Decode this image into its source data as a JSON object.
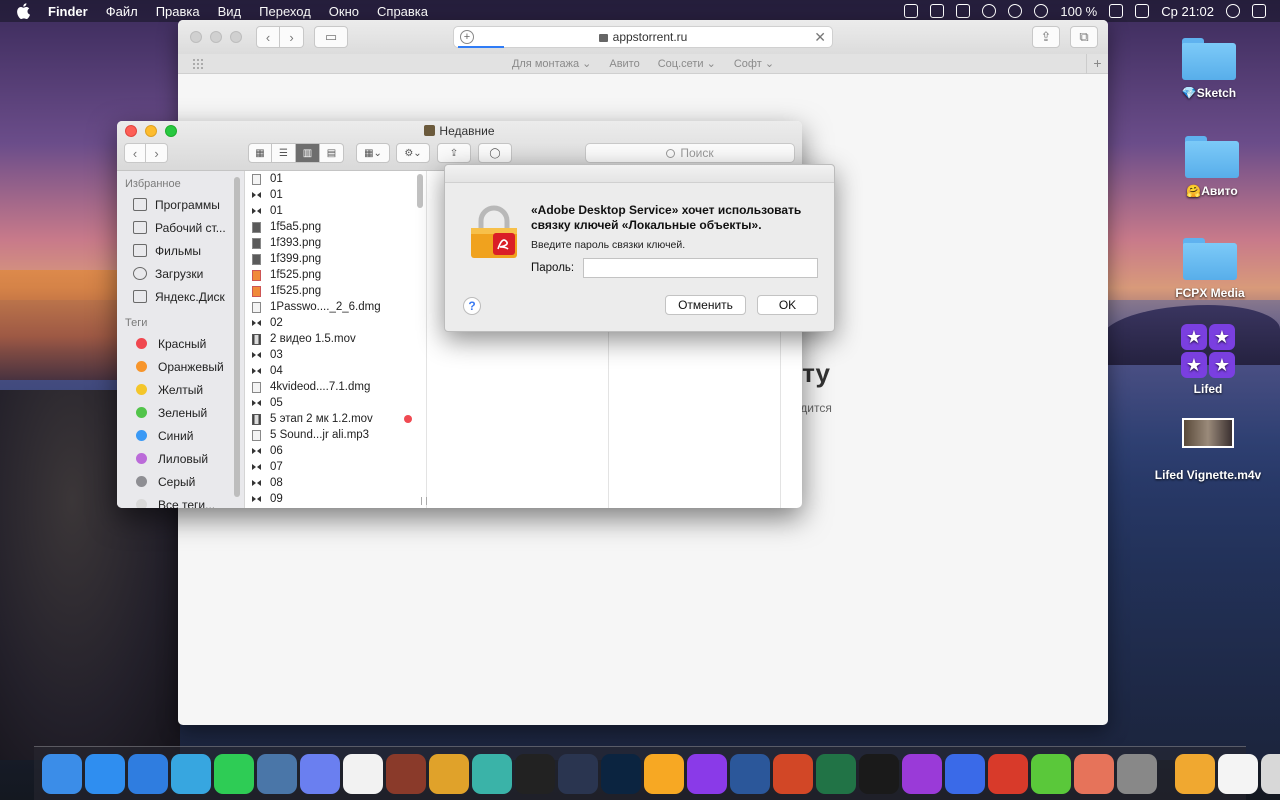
{
  "menubar": {
    "app": "Finder",
    "items": [
      "Файл",
      "Правка",
      "Вид",
      "Переход",
      "Окно",
      "Справка"
    ],
    "battery": "100 %",
    "clock": "Ср 21:02"
  },
  "safari": {
    "url": "appstorrent.ru",
    "favorites": [
      "Для монтажа ⌄",
      "Авито",
      "Соц.сети ⌄",
      "Софт ⌄"
    ],
    "page_heading": "ету",
    "page_sub": "ходится"
  },
  "finder": {
    "title": "Недавние",
    "search_placeholder": "Поиск",
    "sidebar": {
      "favorites_header": "Избранное",
      "favorites": [
        "Программы",
        "Рабочий ст...",
        "Фильмы",
        "Загрузки",
        "Яндекс.Диск"
      ],
      "tags_header": "Теги",
      "tags": [
        {
          "label": "Красный",
          "color": "#f0474f"
        },
        {
          "label": "Оранжевый",
          "color": "#f7952b"
        },
        {
          "label": "Желтый",
          "color": "#f4c62a"
        },
        {
          "label": "Зеленый",
          "color": "#52c44a"
        },
        {
          "label": "Синий",
          "color": "#3a99f5"
        },
        {
          "label": "Лиловый",
          "color": "#bb6bd9"
        },
        {
          "label": "Серый",
          "color": "#8e8e93"
        },
        {
          "label": "Все теги...",
          "color": "#d9d9d9"
        }
      ]
    },
    "files": [
      {
        "name": "01",
        "icon": "doc-icon"
      },
      {
        "name": "01",
        "icon": "bowtie-icon"
      },
      {
        "name": "01",
        "icon": "bowtie-icon"
      },
      {
        "name": "1f5a5.png",
        "icon": "image-icon"
      },
      {
        "name": "1f393.png",
        "icon": "image-icon"
      },
      {
        "name": "1f399.png",
        "icon": "image-icon"
      },
      {
        "name": "1f525.png",
        "icon": "fire-icon"
      },
      {
        "name": "1f525.png",
        "icon": "fire-icon"
      },
      {
        "name": "1Passwo...._2_6.dmg",
        "icon": "disk-image-icon"
      },
      {
        "name": "02",
        "icon": "bowtie-icon"
      },
      {
        "name": "2 видео 1.5.mov",
        "icon": "movie-icon"
      },
      {
        "name": "03",
        "icon": "bowtie-icon"
      },
      {
        "name": "04",
        "icon": "bowtie-icon"
      },
      {
        "name": "4kvideod....7.1.dmg",
        "icon": "disk-image-icon"
      },
      {
        "name": "05",
        "icon": "bowtie-icon"
      },
      {
        "name": "5 этап 2 мк 1.2.mov",
        "icon": "movie-icon",
        "tag": "#f04a52"
      },
      {
        "name": "5 Sound...jr ali.mp3",
        "icon": "audio-icon"
      },
      {
        "name": "06",
        "icon": "bowtie-icon"
      },
      {
        "name": "07",
        "icon": "bowtie-icon"
      },
      {
        "name": "08",
        "icon": "bowtie-icon"
      },
      {
        "name": "09",
        "icon": "bowtie-icon"
      }
    ]
  },
  "dialog": {
    "title": "«Adobe Desktop Service» хочет использовать связку ключей «Локальные объекты».",
    "subtitle": "Введите пароль связки ключей.",
    "password_label": "Пароль:",
    "password_value": "",
    "help": "?",
    "cancel": "Отменить",
    "ok": "OK"
  },
  "desktop": [
    {
      "label": "💎Sketch",
      "kind": "folder"
    },
    {
      "label": "🤗Авито",
      "kind": "folder"
    },
    {
      "label": "FCPX Media",
      "kind": "folder"
    },
    {
      "label": "Lifed",
      "kind": "app"
    },
    {
      "label": "Lifed Vignette.m4v",
      "kind": "video"
    }
  ],
  "dock": [
    {
      "name": "finder-icon",
      "color": "#3b8de8"
    },
    {
      "name": "safari-icon",
      "color": "#2f8ef0"
    },
    {
      "name": "spark-icon",
      "color": "#2f7de0"
    },
    {
      "name": "telegram-icon",
      "color": "#37a6e0"
    },
    {
      "name": "whatsapp-icon",
      "color": "#2ecc55"
    },
    {
      "name": "vk-icon",
      "color": "#4a76a8"
    },
    {
      "name": "discord-icon",
      "color": "#6a7ff0"
    },
    {
      "name": "things-icon",
      "color": "#f2f2f2"
    },
    {
      "name": "wine-icon",
      "color": "#8a3a2a"
    },
    {
      "name": "pineapple-icon",
      "color": "#e0a22a"
    },
    {
      "name": "chatgpt-icon",
      "color": "#3ab3a8"
    },
    {
      "name": "final-cut-icon",
      "color": "#222222"
    },
    {
      "name": "cinema4d-icon",
      "color": "#2a3550"
    },
    {
      "name": "photoshop-icon",
      "color": "#0b2440"
    },
    {
      "name": "sketch-icon",
      "color": "#f7a823"
    },
    {
      "name": "picsart-icon",
      "color": "#8a3ae8"
    },
    {
      "name": "word-icon",
      "color": "#2b579a"
    },
    {
      "name": "powerpoint-icon",
      "color": "#d24726"
    },
    {
      "name": "excel-icon",
      "color": "#217346"
    },
    {
      "name": "infuse-icon",
      "color": "#1a1a1a"
    },
    {
      "name": "motion-icon",
      "color": "#9a3ad8"
    },
    {
      "name": "disk-icon",
      "color": "#3a6ae8"
    },
    {
      "name": "rocket-icon",
      "color": "#d83a2a"
    },
    {
      "name": "download-icon",
      "color": "#5ac83a"
    },
    {
      "name": "deer-icon",
      "color": "#e6735a"
    },
    {
      "name": "system-preferences-icon",
      "color": "#888888"
    },
    {
      "name": "drive-icon",
      "color": "#f0a830"
    },
    {
      "name": "document-icon",
      "color": "#f4f4f4"
    },
    {
      "name": "trash-icon",
      "color": "#d8d8d8"
    }
  ]
}
